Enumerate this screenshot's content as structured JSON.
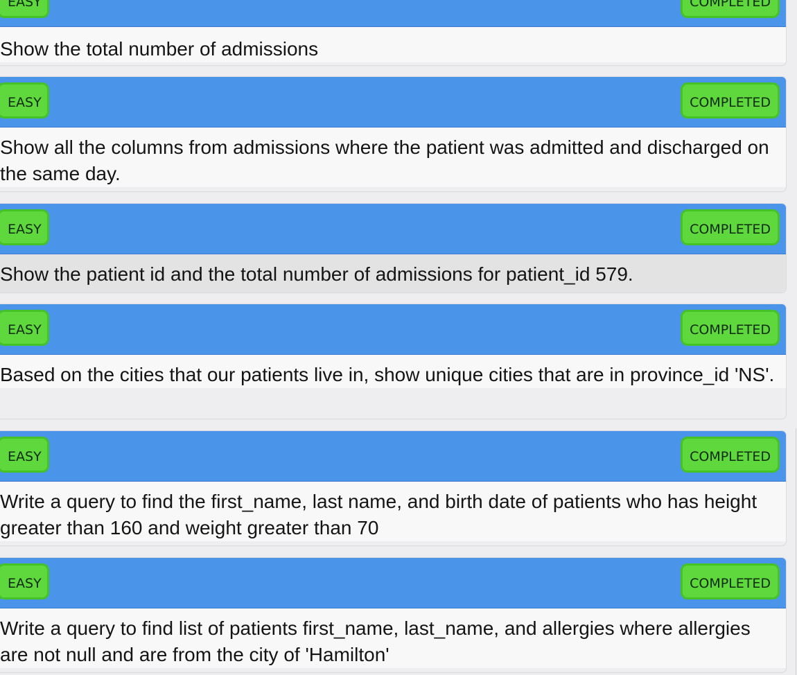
{
  "questions": [
    {
      "difficulty": "EASY",
      "status": "COMPLETED",
      "text": "Show the total number of admissions"
    },
    {
      "difficulty": "EASY",
      "status": "COMPLETED",
      "text": "Show all the columns from admissions where the patient was admitted and discharged on the same day."
    },
    {
      "difficulty": "EASY",
      "status": "COMPLETED",
      "text": "Show the patient id and the total number of admissions for patient_id 579."
    },
    {
      "difficulty": "EASY",
      "status": "COMPLETED",
      "text": "Based on the cities that our patients live in, show unique cities that are in province_id 'NS'."
    },
    {
      "difficulty": "EASY",
      "status": "COMPLETED",
      "text": "Write a query to find the first_name, last name, and birth date of patients who has height greater than 160 and weight greater than 70"
    },
    {
      "difficulty": "EASY",
      "status": "COMPLETED",
      "text": "Write a query to find list of patients first_name, last_name, and allergies where allergies are not null and are from the city of 'Hamilton'"
    }
  ],
  "colors": {
    "header": "#4a94e9",
    "badge": "#5ed83d",
    "badge_border": "#44c228",
    "body": "#f8f8f9",
    "body_highlight": "#e3e3e4"
  }
}
